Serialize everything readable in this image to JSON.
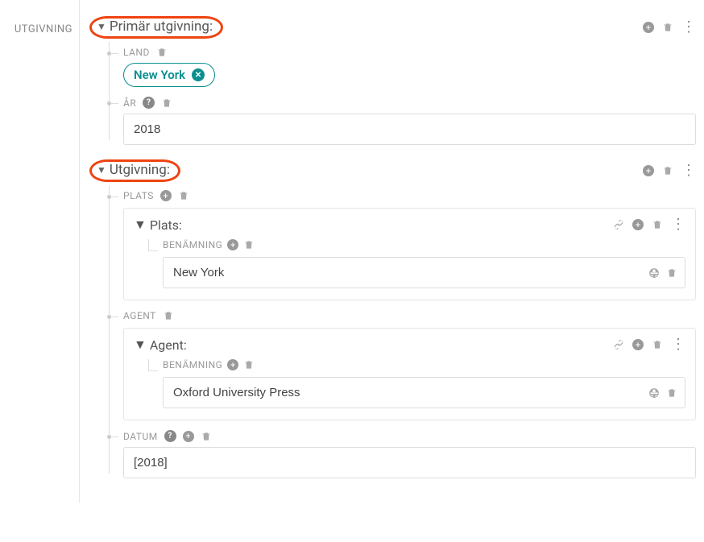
{
  "sidebar": {
    "label": "UTGIVNING"
  },
  "sections": {
    "primary": {
      "title": "Primär utgivning:",
      "land": {
        "label": "LAND",
        "value": "New York"
      },
      "year": {
        "label": "ÅR",
        "value": "2018"
      }
    },
    "secondary": {
      "title": "Utgivning:",
      "plats": {
        "label": "PLATS",
        "card_title": "Plats:",
        "benamning_label": "BENÄMNING",
        "value": "New York"
      },
      "agent": {
        "label": "AGENT",
        "card_title": "Agent:",
        "benamning_label": "BENÄMNING",
        "value": "Oxford University Press"
      },
      "datum": {
        "label": "DATUM",
        "value": "[2018]"
      }
    }
  }
}
